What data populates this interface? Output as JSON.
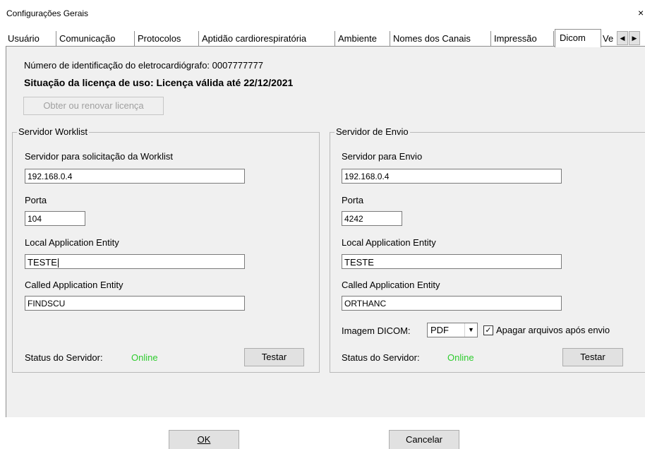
{
  "window": {
    "title": "Configurações Gerais",
    "close_glyph": "×"
  },
  "tabs": [
    {
      "label": "Usuário"
    },
    {
      "label": "Comunicação"
    },
    {
      "label": "Protocolos"
    },
    {
      "label": "Aptidão cardiorespiratória"
    },
    {
      "label": "Ambiente"
    },
    {
      "label": "Nomes dos Canais"
    },
    {
      "label": "Impressão"
    },
    {
      "label": "Dicom",
      "active": true
    },
    {
      "label": "Ve"
    }
  ],
  "tab_scroll": {
    "left": "◀",
    "right": "▶"
  },
  "license": {
    "id_text": "Número de identificação do eletrocardiógrafo: 0007777777",
    "status_text": "Situação da licença de uso:  Licença válida até 22/12/2021",
    "renew_button": "Obter ou renovar licença"
  },
  "worklist": {
    "legend": "Servidor Worklist",
    "server_label": "Servidor para solicitação da Worklist",
    "server_value": "192.168.0.4",
    "port_label": "Porta",
    "port_value": "104",
    "local_ae_label": "Local Application Entity",
    "local_ae_value": "TESTE",
    "called_ae_label": "Called Application Entity",
    "called_ae_value": "FINDSCU",
    "status_label": "Status do Servidor:",
    "status_value": "Online",
    "test_button": "Testar"
  },
  "send": {
    "legend": "Servidor de Envio",
    "server_label": "Servidor para Envio",
    "server_value": "192.168.0.4",
    "port_label": "Porta",
    "port_value": "4242",
    "local_ae_label": "Local Application Entity",
    "local_ae_value": "TESTE",
    "called_ae_label": "Called Application Entity",
    "called_ae_value": "ORTHANC",
    "image_label": "Imagem DICOM:",
    "image_value": "PDF",
    "delete_label": "Apagar arquivos após envio",
    "delete_checked": true,
    "status_label": "Status do Servidor:",
    "status_value": "Online",
    "test_button": "Testar"
  },
  "footer": {
    "ok": "OK",
    "cancel": "Cancelar"
  },
  "colors": {
    "online": "#2ecc2e",
    "panel": "#f0f0f0"
  }
}
